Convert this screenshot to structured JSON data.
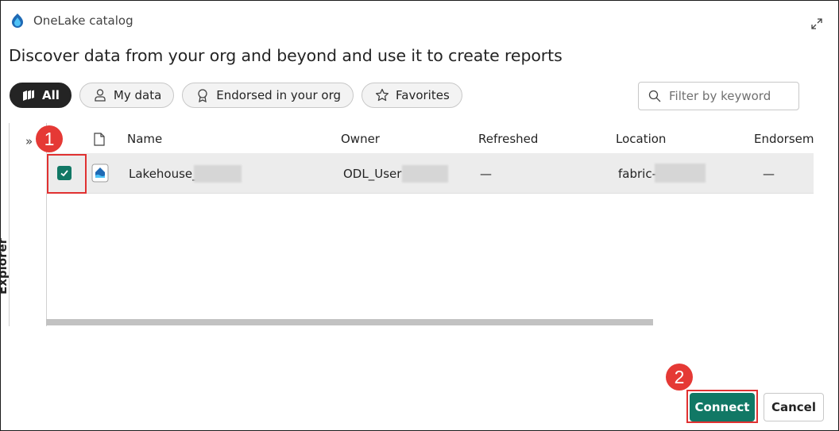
{
  "window": {
    "title": "OneLake catalog"
  },
  "heading": "Discover data from your org and beyond and use it to create reports",
  "filters": {
    "chips": [
      {
        "label": "All",
        "icon": "all-items-icon",
        "active": true
      },
      {
        "label": "My data",
        "icon": "person-icon",
        "active": false
      },
      {
        "label": "Endorsed in your org",
        "icon": "ribbon-icon",
        "active": false
      },
      {
        "label": "Favorites",
        "icon": "star-icon",
        "active": false
      }
    ],
    "search_placeholder": "Filter by keyword"
  },
  "explorer": {
    "label": "Explorer",
    "toggle_icon": "double-chevron-right-icon"
  },
  "table": {
    "columns": [
      "Name",
      "Owner",
      "Refreshed",
      "Location",
      "Endorseme"
    ],
    "rows": [
      {
        "checked": true,
        "icon": "lakehouse-icon",
        "name": "Lakehouse_1",
        "owner": "ODL_User 1",
        "refreshed": "—",
        "location": "fabric-",
        "endorsement": "—"
      }
    ]
  },
  "annotations": {
    "step1": "1",
    "step2": "2"
  },
  "footer": {
    "connect_label": "Connect",
    "cancel_label": "Cancel"
  },
  "colors": {
    "accent": "#117865",
    "callout": "#e53935",
    "active_chip": "#242424"
  }
}
